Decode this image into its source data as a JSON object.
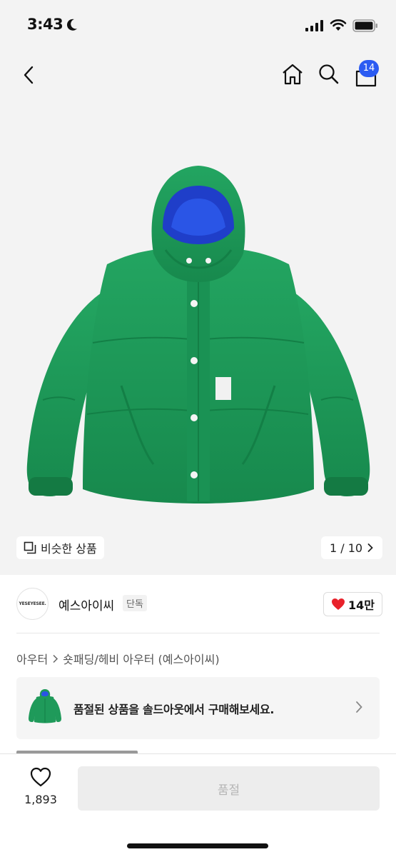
{
  "status_bar": {
    "time": "3:43"
  },
  "nav": {
    "cart_count": "14"
  },
  "gallery": {
    "similar_label": "비슷한 상품",
    "page_indicator": "1 / 10"
  },
  "seller": {
    "logo_text": "YESEYESEE.",
    "name": "예스아이씨",
    "badge": "단독",
    "likes": "14만"
  },
  "breadcrumb": {
    "category": "아우터",
    "subcategory": "숏패딩/헤비 아우터 (예스아이씨)"
  },
  "soldout_banner": {
    "text": "품절된 상품을 솔드아웃에서 구매해보세요."
  },
  "bottom_bar": {
    "wishlist_count": "1,893",
    "buy_label": "품절"
  },
  "colors": {
    "accent_blue": "#2b5bf2",
    "jacket_green": "#1f9a5a",
    "like_red": "#e8212a"
  },
  "icons": [
    "moon-icon",
    "signal-icon",
    "wifi-icon",
    "battery-icon",
    "back-icon",
    "home-icon",
    "search-icon",
    "shopping-bag-icon",
    "similar-items-icon",
    "chevron-right-icon",
    "heart-icon"
  ]
}
